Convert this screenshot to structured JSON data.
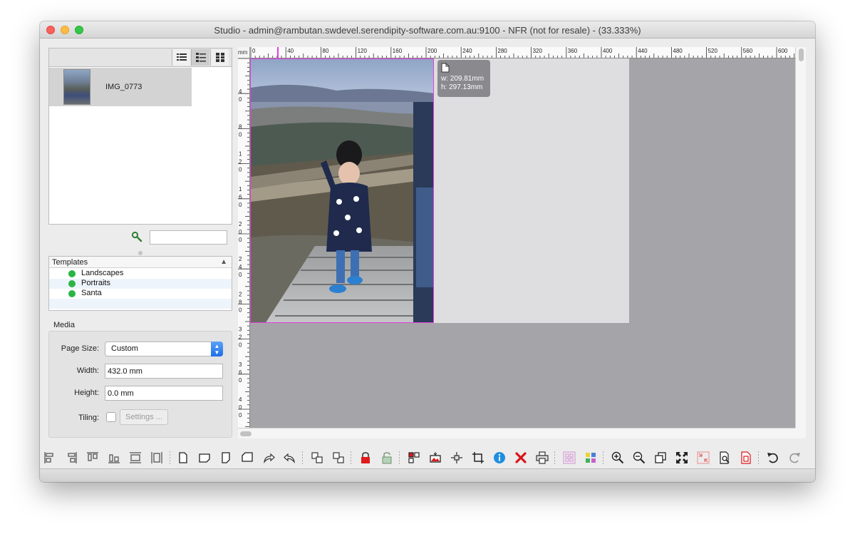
{
  "window": {
    "title": "Studio - admin@rambutan.swdevel.serendipity-software.com.au:9100 - NFR (not for resale) - (33.333%)"
  },
  "image_browser": {
    "view_modes": [
      "list-view-icon",
      "detail-view-icon",
      "grid-view-icon"
    ],
    "active_view": 1,
    "items": [
      {
        "name": "IMG_0773"
      }
    ],
    "search": {
      "value": "",
      "placeholder": ""
    }
  },
  "templates": {
    "header": "Templates",
    "items": [
      {
        "label": "Landscapes",
        "status_color": "#2bb544"
      },
      {
        "label": "Portraits",
        "status_color": "#2bb544"
      },
      {
        "label": "Santa",
        "status_color": "#2bb544"
      }
    ]
  },
  "media": {
    "legend": "Media",
    "page_size_label": "Page Size:",
    "page_size_value": "Custom",
    "width_label": "Width:",
    "width_value": "432.0 mm",
    "height_label": "Height:",
    "height_value": "0.0 mm",
    "tiling_label": "Tiling:",
    "tiling_checked": false,
    "settings_label": "Settings ..."
  },
  "canvas": {
    "ruler_unit": "mm",
    "h_ruler_labels": [
      "0",
      "40",
      "80",
      "120",
      "160",
      "200",
      "240",
      "280",
      "320",
      "360",
      "400",
      "440",
      "480",
      "520",
      "560",
      "600"
    ],
    "v_ruler_labels": [
      [
        "4",
        "0"
      ],
      [
        "8",
        "0"
      ],
      [
        "1",
        "2",
        "0"
      ],
      [
        "1",
        "6",
        "0"
      ],
      [
        "2",
        "0",
        "0"
      ],
      [
        "2",
        "4",
        "0"
      ],
      [
        "2",
        "8",
        "0"
      ],
      [
        "3",
        "2",
        "0"
      ],
      [
        "3",
        "6",
        "0"
      ],
      [
        "4",
        "0",
        "0"
      ]
    ],
    "selection_width": "w: 209.81mm",
    "selection_height": "h: 297.13mm",
    "zoom": "33.333%"
  },
  "colors": {
    "selection": "#e23de0",
    "template_status": "#2bb544",
    "canvas_bg": "#a5a5a9",
    "paper": "#dedee0"
  }
}
